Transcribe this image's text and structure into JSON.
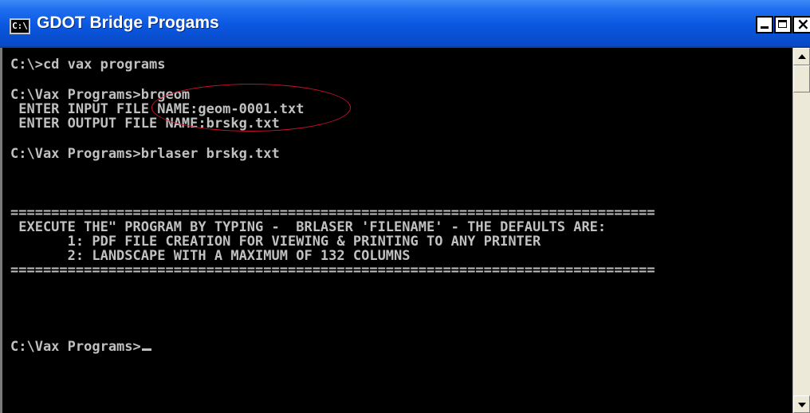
{
  "window": {
    "title": "GDOT Bridge Progams",
    "icon_label": "C:\\"
  },
  "console": {
    "lines": [
      "C:\\>cd vax programs",
      "C:\\Vax Programs>brgeom",
      " ENTER INPUT FILE NAME:geom-0001.txt",
      " ENTER OUTPUT FILE NAME:brskg.txt",
      "C:\\Vax Programs>brlaser brskg.txt",
      "===============================================================================",
      " EXECUTE THE\" PROGRAM BY TYPING -  BRLASER 'FILENAME' - THE DEFAULTS ARE:",
      "       1: PDF FILE CREATION FOR VIEWING & PRINTING TO ANY PRINTER",
      "       2: LANDSCAPE WITH A MAXIMUM OF 132 COLUMNS",
      "===============================================================================",
      "C:\\Vax Programs>"
    ]
  },
  "colors": {
    "console_bg": "#000000",
    "console_text": "#c0c0c0",
    "titlebar": "#0a57e0",
    "highlight": "#c8102e"
  }
}
